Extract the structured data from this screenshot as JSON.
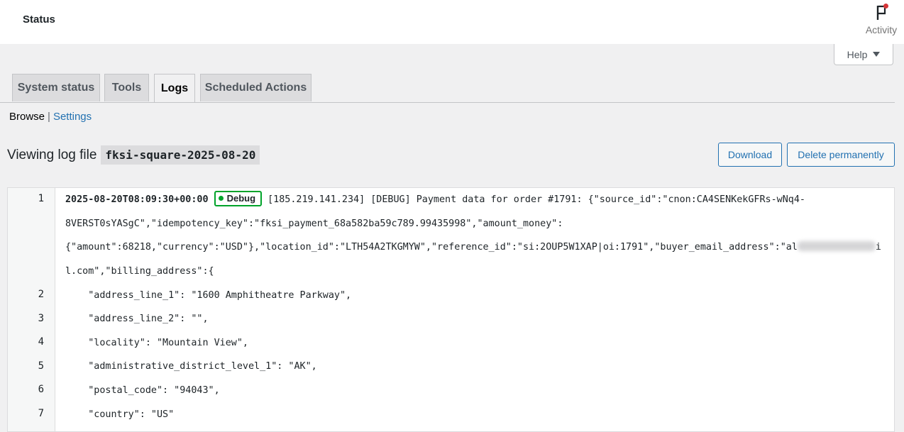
{
  "header": {
    "title": "Status",
    "activity_label": "Activity"
  },
  "help": {
    "label": "Help"
  },
  "tabs": [
    {
      "label": "System status"
    },
    {
      "label": "Tools"
    },
    {
      "label": "Logs"
    },
    {
      "label": "Scheduled Actions"
    }
  ],
  "subnav": {
    "current": "Browse",
    "separator": "|",
    "settings": "Settings"
  },
  "viewer": {
    "title": "Viewing log file",
    "filename": "fksi-square-2025-08-20",
    "download_label": "Download",
    "delete_label": "Delete permanently"
  },
  "log": {
    "timestamp": "2025-08-20T08:09:30+00:00",
    "level": "Debug",
    "level_color": "#00a32a",
    "line1_a": " [185.219.141.234] [DEBUG] Payment data for order #1791: {\"source_id\":\"cnon:CA4SENKekGFRs-wNq4-",
    "line1_b": "8VERST0sYASgC\",\"idempotency_key\":\"fksi_payment_68a582ba59c789.99435998\",\"amount_money\":",
    "line1_c_pre": "{\"amount\":68218,\"currency\":\"USD\"},\"location_id\":\"LTH54A2TKGMYW\",\"reference_id\":\"si:2OUP5W1XAP|oi:1791\",\"buyer_email_address\":\"al",
    "line1_c_post": "i",
    "line1_d": "l.com\",\"billing_address\":{",
    "lines": [
      {
        "n": "1"
      },
      {
        "n": "2",
        "text": "    \"address_line_1\": \"1600 Amphitheatre Parkway\","
      },
      {
        "n": "3",
        "text": "    \"address_line_2\": \"\","
      },
      {
        "n": "4",
        "text": "    \"locality\": \"Mountain View\","
      },
      {
        "n": "5",
        "text": "    \"administrative_district_level_1\": \"AK\","
      },
      {
        "n": "6",
        "text": "    \"postal_code\": \"94043\","
      },
      {
        "n": "7",
        "text": "    \"country\": \"US\""
      }
    ]
  }
}
